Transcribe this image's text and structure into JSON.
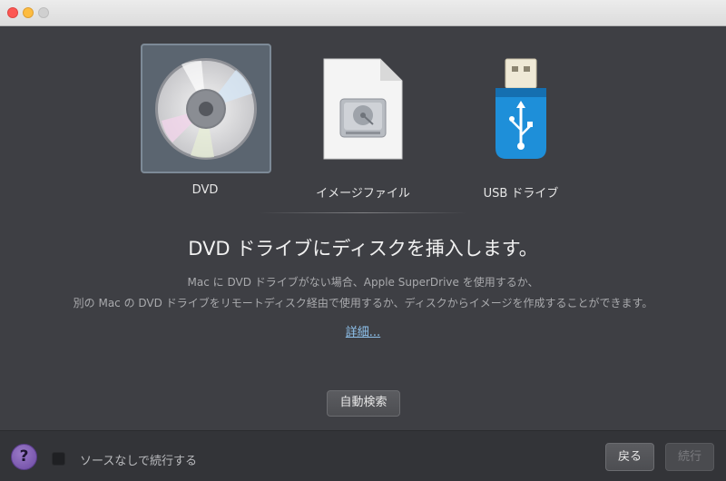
{
  "sources": [
    {
      "label": "DVD",
      "icon": "dvd-disc-icon",
      "selected": true
    },
    {
      "label": "イメージファイル",
      "icon": "image-file-icon",
      "selected": false
    },
    {
      "label": "USB ドライブ",
      "icon": "usb-drive-icon",
      "selected": false
    }
  ],
  "headline": "DVD ドライブにディスクを挿入します。",
  "description": {
    "line1": "Mac に DVD ドライブがない場合、Apple SuperDrive を使用するか、",
    "line2": "別の Mac の DVD ドライブをリモートディスク経由で使用するか、ディスクからイメージを作成することができます。"
  },
  "details_link": "詳細...",
  "auto_search_label": "自動検索",
  "footer": {
    "help_label": "?",
    "continue_without_source_label": "ソースなしで続行する",
    "back_label": "戻る",
    "next_label": "続行"
  },
  "colors": {
    "background": "#3e3f44",
    "selected_tile": "#5b6570",
    "link": "#8fc3ee",
    "help_purple": "#7b58b0",
    "usb_blue": "#1e8fd9"
  }
}
